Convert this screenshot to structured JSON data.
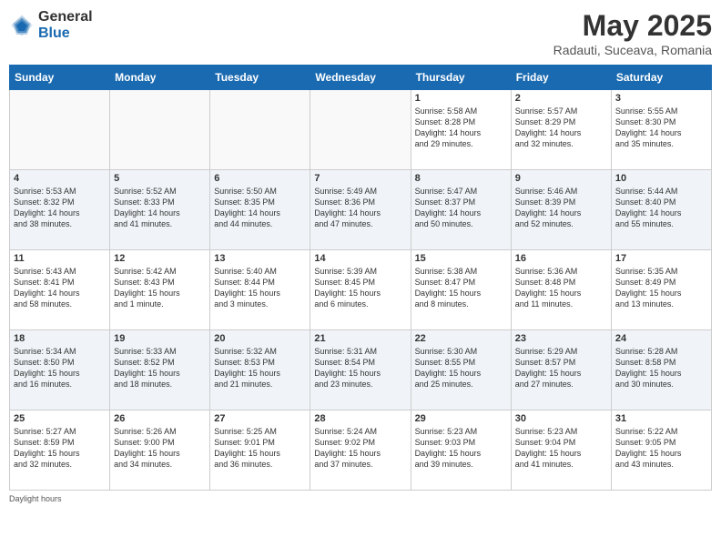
{
  "logo": {
    "general": "General",
    "blue": "Blue"
  },
  "title": "May 2025",
  "subtitle": "Radauti, Suceava, Romania",
  "days_header": [
    "Sunday",
    "Monday",
    "Tuesday",
    "Wednesday",
    "Thursday",
    "Friday",
    "Saturday"
  ],
  "weeks": [
    [
      {
        "num": "",
        "info": ""
      },
      {
        "num": "",
        "info": ""
      },
      {
        "num": "",
        "info": ""
      },
      {
        "num": "",
        "info": ""
      },
      {
        "num": "1",
        "info": "Sunrise: 5:58 AM\nSunset: 8:28 PM\nDaylight: 14 hours\nand 29 minutes."
      },
      {
        "num": "2",
        "info": "Sunrise: 5:57 AM\nSunset: 8:29 PM\nDaylight: 14 hours\nand 32 minutes."
      },
      {
        "num": "3",
        "info": "Sunrise: 5:55 AM\nSunset: 8:30 PM\nDaylight: 14 hours\nand 35 minutes."
      }
    ],
    [
      {
        "num": "4",
        "info": "Sunrise: 5:53 AM\nSunset: 8:32 PM\nDaylight: 14 hours\nand 38 minutes."
      },
      {
        "num": "5",
        "info": "Sunrise: 5:52 AM\nSunset: 8:33 PM\nDaylight: 14 hours\nand 41 minutes."
      },
      {
        "num": "6",
        "info": "Sunrise: 5:50 AM\nSunset: 8:35 PM\nDaylight: 14 hours\nand 44 minutes."
      },
      {
        "num": "7",
        "info": "Sunrise: 5:49 AM\nSunset: 8:36 PM\nDaylight: 14 hours\nand 47 minutes."
      },
      {
        "num": "8",
        "info": "Sunrise: 5:47 AM\nSunset: 8:37 PM\nDaylight: 14 hours\nand 50 minutes."
      },
      {
        "num": "9",
        "info": "Sunrise: 5:46 AM\nSunset: 8:39 PM\nDaylight: 14 hours\nand 52 minutes."
      },
      {
        "num": "10",
        "info": "Sunrise: 5:44 AM\nSunset: 8:40 PM\nDaylight: 14 hours\nand 55 minutes."
      }
    ],
    [
      {
        "num": "11",
        "info": "Sunrise: 5:43 AM\nSunset: 8:41 PM\nDaylight: 14 hours\nand 58 minutes."
      },
      {
        "num": "12",
        "info": "Sunrise: 5:42 AM\nSunset: 8:43 PM\nDaylight: 15 hours\nand 1 minute."
      },
      {
        "num": "13",
        "info": "Sunrise: 5:40 AM\nSunset: 8:44 PM\nDaylight: 15 hours\nand 3 minutes."
      },
      {
        "num": "14",
        "info": "Sunrise: 5:39 AM\nSunset: 8:45 PM\nDaylight: 15 hours\nand 6 minutes."
      },
      {
        "num": "15",
        "info": "Sunrise: 5:38 AM\nSunset: 8:47 PM\nDaylight: 15 hours\nand 8 minutes."
      },
      {
        "num": "16",
        "info": "Sunrise: 5:36 AM\nSunset: 8:48 PM\nDaylight: 15 hours\nand 11 minutes."
      },
      {
        "num": "17",
        "info": "Sunrise: 5:35 AM\nSunset: 8:49 PM\nDaylight: 15 hours\nand 13 minutes."
      }
    ],
    [
      {
        "num": "18",
        "info": "Sunrise: 5:34 AM\nSunset: 8:50 PM\nDaylight: 15 hours\nand 16 minutes."
      },
      {
        "num": "19",
        "info": "Sunrise: 5:33 AM\nSunset: 8:52 PM\nDaylight: 15 hours\nand 18 minutes."
      },
      {
        "num": "20",
        "info": "Sunrise: 5:32 AM\nSunset: 8:53 PM\nDaylight: 15 hours\nand 21 minutes."
      },
      {
        "num": "21",
        "info": "Sunrise: 5:31 AM\nSunset: 8:54 PM\nDaylight: 15 hours\nand 23 minutes."
      },
      {
        "num": "22",
        "info": "Sunrise: 5:30 AM\nSunset: 8:55 PM\nDaylight: 15 hours\nand 25 minutes."
      },
      {
        "num": "23",
        "info": "Sunrise: 5:29 AM\nSunset: 8:57 PM\nDaylight: 15 hours\nand 27 minutes."
      },
      {
        "num": "24",
        "info": "Sunrise: 5:28 AM\nSunset: 8:58 PM\nDaylight: 15 hours\nand 30 minutes."
      }
    ],
    [
      {
        "num": "25",
        "info": "Sunrise: 5:27 AM\nSunset: 8:59 PM\nDaylight: 15 hours\nand 32 minutes."
      },
      {
        "num": "26",
        "info": "Sunrise: 5:26 AM\nSunset: 9:00 PM\nDaylight: 15 hours\nand 34 minutes."
      },
      {
        "num": "27",
        "info": "Sunrise: 5:25 AM\nSunset: 9:01 PM\nDaylight: 15 hours\nand 36 minutes."
      },
      {
        "num": "28",
        "info": "Sunrise: 5:24 AM\nSunset: 9:02 PM\nDaylight: 15 hours\nand 37 minutes."
      },
      {
        "num": "29",
        "info": "Sunrise: 5:23 AM\nSunset: 9:03 PM\nDaylight: 15 hours\nand 39 minutes."
      },
      {
        "num": "30",
        "info": "Sunrise: 5:23 AM\nSunset: 9:04 PM\nDaylight: 15 hours\nand 41 minutes."
      },
      {
        "num": "31",
        "info": "Sunrise: 5:22 AM\nSunset: 9:05 PM\nDaylight: 15 hours\nand 43 minutes."
      }
    ]
  ],
  "footer": "Daylight hours"
}
